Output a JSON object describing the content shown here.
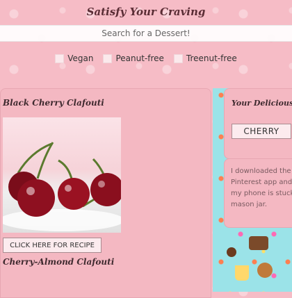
{
  "header": {
    "title": "Satisfy Your Craving"
  },
  "search": {
    "text": "Search for a Dessert!"
  },
  "filters": [
    {
      "label": "Vegan"
    },
    {
      "label": "Peanut-free"
    },
    {
      "label": "Treenut-free"
    }
  ],
  "recipes": [
    {
      "title": "Black Cherry Clafouti",
      "button_label": "CLICK HERE FOR RECIPE"
    },
    {
      "title": "Cherry-Almond Clafouti"
    }
  ],
  "sidebar": {
    "title": "Your Delicious S",
    "tag": "CHERRY",
    "note_lines": [
      "I downloaded the",
      "Pinterest app and",
      "my phone is stuck",
      "mason jar."
    ]
  },
  "colors": {
    "background": "#f6bcc6",
    "accent_teal": "#9be3e8",
    "title_text": "#5a2d35"
  }
}
